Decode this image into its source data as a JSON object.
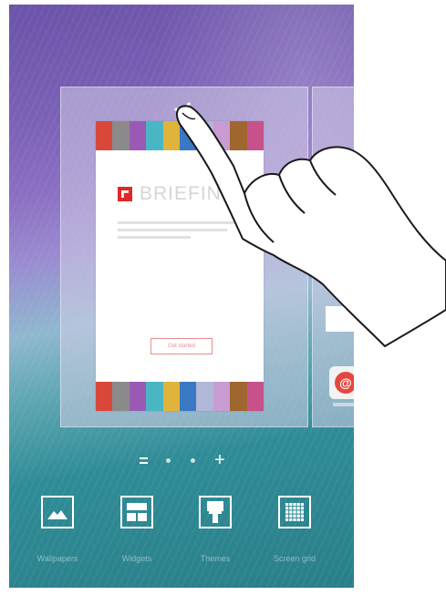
{
  "widget": {
    "title": "BRIEFING",
    "strip_colors": [
      "#d9473a",
      "#8a8a8a",
      "#9b59b6",
      "#49b6c4",
      "#e0b43b",
      "#3a78c3",
      "#b0b7d8",
      "#c89bd3",
      "#a0662f",
      "#c7528b"
    ],
    "button_label": "Get started"
  },
  "page_indicator": {
    "plus": "+"
  },
  "next_panel": {
    "app_icon_glyph": "@"
  },
  "edit_options": [
    {
      "label": "Wallpapers",
      "icon": "wallpaper-icon"
    },
    {
      "label": "Widgets",
      "icon": "widgets-icon"
    },
    {
      "label": "Themes",
      "icon": "themes-icon"
    },
    {
      "label": "Screen grid",
      "icon": "screen-grid-icon"
    }
  ],
  "colors": {
    "accent_red": "#e12828",
    "overlay": "#d2cde6"
  }
}
